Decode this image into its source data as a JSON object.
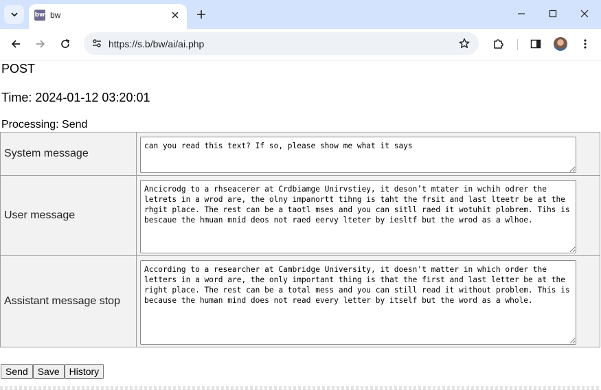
{
  "browser": {
    "tab_title": "bw",
    "favicon_text": "bw",
    "url": "https://s.b/bw/ai/ai.php"
  },
  "page": {
    "method": "POST",
    "time": "Time: 2024-01-12 03:20:01",
    "processing": "Processing: Send",
    "rows": [
      {
        "label": "System message",
        "value": "can you read this text? If so, please show me what it says"
      },
      {
        "label": "User message",
        "value": "Ancicrodg to a rhseacerer at Crdbiamge Unirvstiey, it deson’t mtater in wchih odrer the letrets in a wrod are, the olny impanortt tihng is taht the frsit and last lteetr be at the rhgit place. The rest can be a taotl mses and you can sitll raed it wotuhit plobrem. Tihs is bescaue the hmuan mnid deos not raed eervy lteter by iesltf but the wrod as a wlhoe."
      },
      {
        "label": "Assistant message stop",
        "value": "According to a researcher at Cambridge University, it doesn't matter in which order the letters in a word are, the only important thing is that the first and last letter be at the right place. The rest can be a total mess and you can still read it without problem. This is because the human mind does not read every letter by itself but the word as a whole."
      }
    ],
    "buttons": {
      "send": "Send",
      "save": "Save",
      "history": "History"
    }
  }
}
